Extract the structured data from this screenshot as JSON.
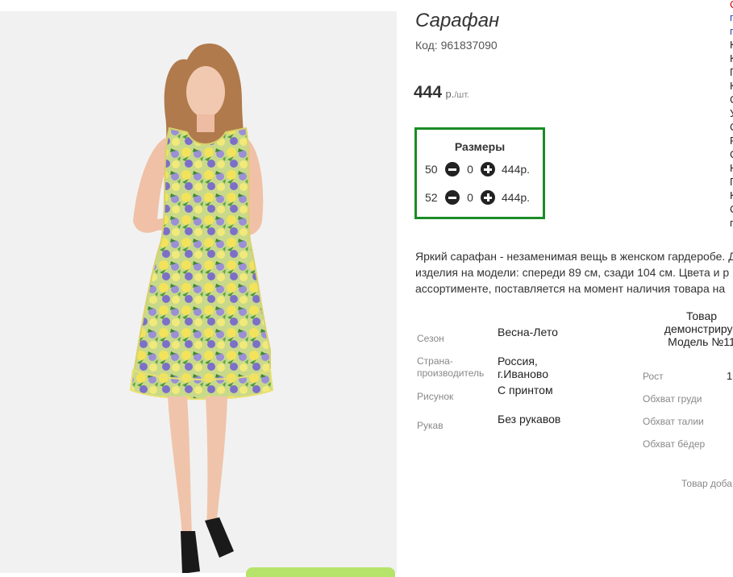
{
  "product": {
    "title": "Сарафан",
    "code_label": "Код:",
    "code_value": "961837090",
    "price_value": "444",
    "price_unit": "р.",
    "price_per": "/шт."
  },
  "sizes": {
    "title": "Размеры",
    "rows": [
      {
        "size": "50",
        "qty": "0",
        "price": "444р."
      },
      {
        "size": "52",
        "qty": "0",
        "price": "444р."
      }
    ]
  },
  "description": {
    "lines": [
      "Яркий сарафан - незаменимая вещь в женском гардеробе. Д",
      "изделия на модели: спереди 89 см, сзади 104 см. Цвета и р",
      "ассортименте, поставляется на момент наличия товара на"
    ]
  },
  "attributes": [
    {
      "label": "Сезон",
      "value": "Весна-Лето"
    },
    {
      "label": "Страна-производитель",
      "value": "Россия, г.Иваново"
    },
    {
      "label": "Рисунок",
      "value": "С принтом"
    },
    {
      "label": "Рукав",
      "value": "Без рукавов"
    }
  ],
  "model": {
    "title_lines": [
      "Товар",
      "демонстрируе",
      "Модель №11"
    ],
    "measures": [
      {
        "label": "Рост",
        "value": "1"
      },
      {
        "label": "Обхват груди",
        "value": ""
      },
      {
        "label": "Обхват талии",
        "value": ""
      },
      {
        "label": "Обхват бёдер",
        "value": ""
      }
    ]
  },
  "footer_note": "Товар доба",
  "right_column_letters": [
    "С",
    "п",
    "п",
    "К",
    "К",
    "П",
    "К",
    "С",
    "У",
    "С",
    "Р",
    "С",
    "Н",
    "П",
    "К",
    "С",
    "п"
  ],
  "colors": {
    "accent_green": "#1a8c26",
    "photo_background": "#f1f1f1",
    "right_link_red": "#cc0000",
    "right_link_blue": "#2244aa"
  },
  "icons": [
    "minus-circle-icon",
    "plus-circle-icon"
  ]
}
